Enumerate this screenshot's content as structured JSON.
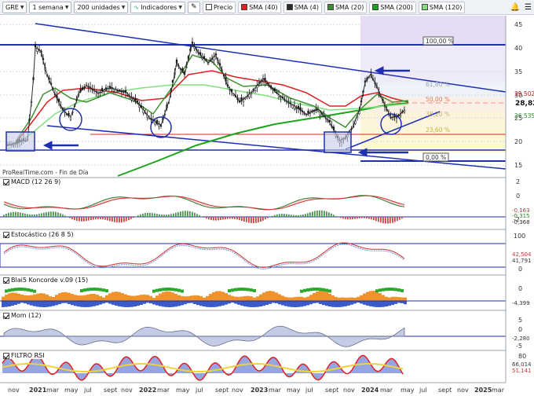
{
  "toolbar": {
    "ticker": "GRE",
    "period": "1 semana",
    "units": "200 unidades",
    "indicators": "Indicadores",
    "legend": [
      {
        "label": "Precio",
        "color": "#ffffff"
      },
      {
        "label": "SMA (40)",
        "color": "#e02020"
      },
      {
        "label": "SMA (4)",
        "color": "#2a2a2a"
      },
      {
        "label": "SMA (20)",
        "color": "#3f8f2f"
      },
      {
        "label": "SMA (200)",
        "color": "#1aa51a"
      },
      {
        "label": "SMA (120)",
        "color": "#7fe07f"
      }
    ]
  },
  "price": {
    "axis_labels": [
      "45",
      "40",
      "35",
      "30",
      "25",
      "20",
      "15"
    ],
    "last_price": "28,82",
    "price_tags": [
      "29,502",
      "26,535"
    ],
    "fib_labels": [
      "100,00 %",
      "61,80 %",
      "50,00 %",
      "38,20 %",
      "23,60 %",
      "0,00 %"
    ],
    "watermark": "ProRealTime.com - Fin de Día"
  },
  "panels": {
    "macd": {
      "title": "MACD (12 26 9)",
      "axis": [
        "2",
        "0",
        "-2"
      ],
      "tags": [
        "-0,163",
        "-0,315",
        "-0,368"
      ]
    },
    "stoch": {
      "title": "Estocástico (26 8 5)",
      "axis": [
        "100",
        "0"
      ],
      "tags": [
        "42,504",
        "41,791"
      ]
    },
    "koncorde": {
      "title": "Blai5 Koncorde v.09 (15)",
      "axis": [
        "0"
      ],
      "tags": [
        "-4,399"
      ]
    },
    "mom": {
      "title": "Mom (12)",
      "axis": [
        "5",
        "0",
        "-5"
      ],
      "tags": [
        "-2,280"
      ]
    },
    "rsi": {
      "title": "FILTRO RSI",
      "axis": [
        "80"
      ],
      "tags": [
        "66,014",
        "51,141"
      ]
    }
  },
  "x_axis": [
    "nov",
    "2021",
    "mar",
    "may",
    "jul",
    "sept",
    "nov",
    "2022",
    "mar",
    "may",
    "jul",
    "sept",
    "nov",
    "2023",
    "mar",
    "may",
    "jul",
    "sept",
    "nov",
    "2024",
    "mar",
    "may",
    "jul",
    "sept",
    "nov",
    "2025",
    "mar"
  ]
}
